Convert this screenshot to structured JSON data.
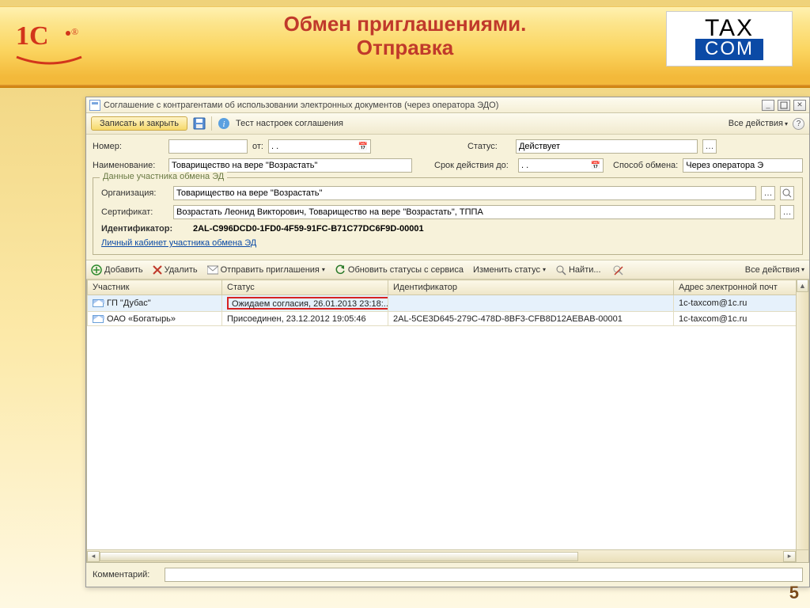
{
  "slide": {
    "title1": "Обмен приглашениями.",
    "title2": "Отправка",
    "pagenum": "5"
  },
  "window": {
    "title": "Соглашение с контрагентами об использовании электронных документов (через оператора ЭДО)"
  },
  "cmdbar": {
    "save_close": "Записать и закрыть",
    "test_settings": "Тест настроек соглашения",
    "all_actions": "Все действия"
  },
  "form": {
    "number_lbl": "Номер:",
    "number_val": "",
    "from_lbl": "от:",
    "from_val": " .  .  ",
    "status_lbl": "Статус:",
    "status_val": "Действует",
    "name_lbl": "Наименование:",
    "name_val": "Товарищество на вере \"Возрастать\"",
    "term_lbl": "Срок действия до:",
    "term_val": " .  .  ",
    "method_lbl": "Способ обмена:",
    "method_val": "Через оператора Э"
  },
  "group": {
    "legend": "Данные участника обмена ЭД",
    "org_lbl": "Организация:",
    "org_val": "Товарищество на вере \"Возрастать\"",
    "cert_lbl": "Сертификат:",
    "cert_val": "Возрастать Леонид Викторович, Товарищество на вере \"Возрастать\", ТППА",
    "ident_lbl": "Идентификатор:",
    "ident_val": "2AL-C996DCD0-1FD0-4F59-91FC-B71C77DC6F9D-00001",
    "link": "Личный кабинет участника обмена ЭД"
  },
  "tbar": {
    "add": "Добавить",
    "delete": "Удалить",
    "send": "Отправить приглашения",
    "refresh": "Обновить статусы с сервиса",
    "change": "Изменить статус",
    "find": "Найти...",
    "all_actions": "Все действия"
  },
  "table": {
    "cols": {
      "participant": "Участник",
      "status": "Статус",
      "ident": "Идентификатор",
      "email": "Адрес электронной почт"
    },
    "rows": [
      {
        "participant": "ГП \"Дубас\"",
        "status": "Ожидаем согласия, 26.01.2013 23:18:...",
        "ident": "",
        "email": "1c-taxcom@1c.ru",
        "highlight": true
      },
      {
        "participant": "ОАО «Богатырь»",
        "status": "Присоединен, 23.12.2012 19:05:46",
        "ident": "2AL-5CE3D645-279C-478D-8BF3-CFB8D12AEBAB-00001",
        "email": "1c-taxcom@1c.ru",
        "highlight": false
      }
    ]
  },
  "footer": {
    "comment_lbl": "Комментарий:",
    "comment_val": ""
  }
}
